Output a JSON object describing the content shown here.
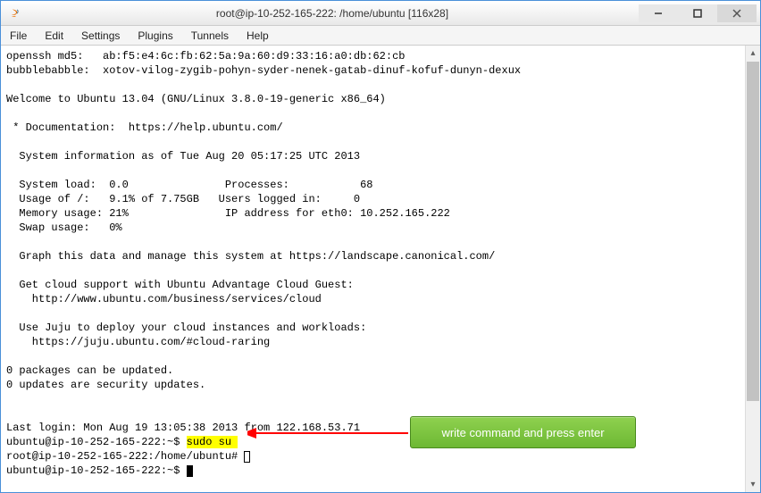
{
  "window": {
    "title": "root@ip-10-252-165-222: /home/ubuntu [116x28]"
  },
  "menu": {
    "items": [
      "File",
      "Edit",
      "Settings",
      "Plugins",
      "Tunnels",
      "Help"
    ]
  },
  "terminal": {
    "lines": [
      "openssh md5:   ab:f5:e4:6c:fb:62:5a:9a:60:d9:33:16:a0:db:62:cb",
      "bubblebabble:  xotov-vilog-zygib-pohyn-syder-nenek-gatab-dinuf-kofuf-dunyn-dexux",
      "",
      "Welcome to Ubuntu 13.04 (GNU/Linux 3.8.0-19-generic x86_64)",
      "",
      " * Documentation:  https://help.ubuntu.com/",
      "",
      "  System information as of Tue Aug 20 05:17:25 UTC 2013",
      "",
      "  System load:  0.0               Processes:           68",
      "  Usage of /:   9.1% of 7.75GB   Users logged in:     0",
      "  Memory usage: 21%               IP address for eth0: 10.252.165.222",
      "  Swap usage:   0%",
      "",
      "  Graph this data and manage this system at https://landscape.canonical.com/",
      "",
      "  Get cloud support with Ubuntu Advantage Cloud Guest:",
      "    http://www.ubuntu.com/business/services/cloud",
      "",
      "  Use Juju to deploy your cloud instances and workloads:",
      "    https://juju.ubuntu.com/#cloud-raring",
      "",
      "0 packages can be updated.",
      "0 updates are security updates.",
      "",
      "",
      "Last login: Mon Aug 19 13:05:38 2013 from 122.168.53.71"
    ],
    "prompt1_prefix": "ubuntu@ip-10-252-165-222:~$ ",
    "prompt1_cmd": "sudo su ",
    "prompt2": "root@ip-10-252-165-222:/home/ubuntu# ",
    "prompt3": "ubuntu@ip-10-252-165-222:~$ "
  },
  "callout": {
    "text": "write command and press enter"
  }
}
